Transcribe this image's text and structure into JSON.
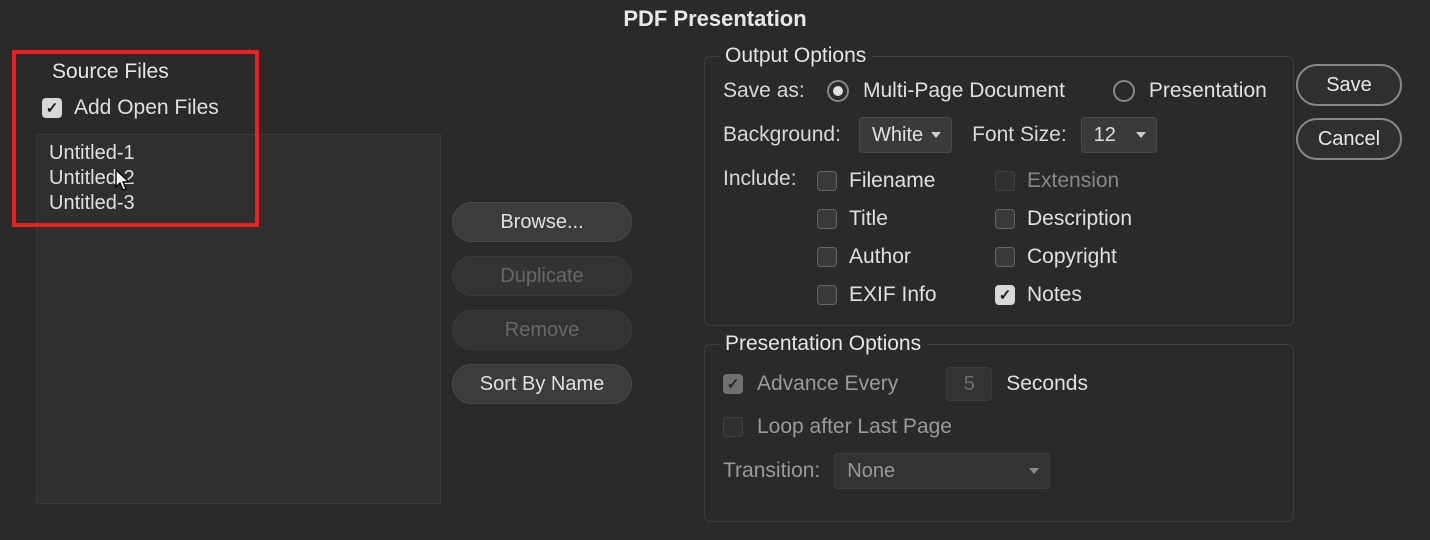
{
  "window": {
    "title": "PDF Presentation"
  },
  "source": {
    "section_title": "Source Files",
    "add_open_label": "Add Open Files",
    "files": [
      "Untitled-1",
      "Untitled-2",
      "Untitled-3"
    ]
  },
  "buttons_col": {
    "browse": "Browse...",
    "duplicate": "Duplicate",
    "remove": "Remove",
    "sort": "Sort By Name"
  },
  "output": {
    "section_title": "Output Options",
    "save_as_label": "Save as:",
    "multi_page": "Multi-Page Document",
    "presentation": "Presentation",
    "background_label": "Background:",
    "background_value": "White",
    "font_size_label": "Font Size:",
    "font_size_value": "12",
    "include_label": "Include:",
    "include": {
      "filename": "Filename",
      "extension": "Extension",
      "title": "Title",
      "description": "Description",
      "author": "Author",
      "copyright": "Copyright",
      "exif": "EXIF Info",
      "notes": "Notes"
    }
  },
  "presentation": {
    "section_title": "Presentation Options",
    "advance_label": "Advance Every",
    "advance_value": "5",
    "seconds": "Seconds",
    "loop": "Loop after Last Page",
    "transition_label": "Transition:",
    "transition_value": "None"
  },
  "actions": {
    "save": "Save",
    "cancel": "Cancel"
  }
}
